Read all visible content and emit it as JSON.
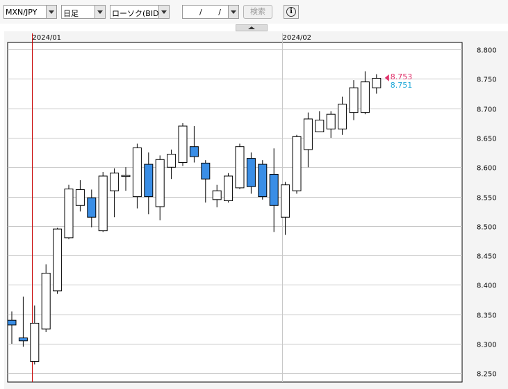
{
  "toolbar": {
    "pair": "MXN/JPY",
    "period": "日足",
    "chart_kind": "ローソク(BID)",
    "date_value": "/ /",
    "search_label": "検索",
    "info_glyph": "i",
    "icons": [
      "dropdown-arrow-icon",
      "info-icon",
      "collapse-up-icon"
    ]
  },
  "colors": {
    "up_fill": "#ffffff",
    "down_fill": "#3a8ee6",
    "candle_stroke": "#000000",
    "grid": "#c8c8c8",
    "month_separator": "#c8c8c8",
    "cursor_line": "#c80000",
    "ask_label": "#e0306a",
    "bid_label": "#1fa8d8"
  },
  "chart_data": {
    "type": "candlestick",
    "y_ticks": [
      "8.800",
      "8.750",
      "8.700",
      "8.650",
      "8.600",
      "8.550",
      "8.500",
      "8.450",
      "8.400",
      "8.350",
      "8.300",
      "8.250"
    ],
    "ylim": [
      8.235,
      8.812
    ],
    "x_month_labels": [
      {
        "label": "2024/01",
        "index": 1.75
      },
      {
        "label": "2024/02",
        "index": 23.75
      }
    ],
    "grid": true,
    "current_prices": [
      {
        "label": "8.753",
        "value": 8.753,
        "role": "ask"
      },
      {
        "label": "8.751",
        "value": 8.751,
        "role": "bid"
      }
    ],
    "candles": [
      {
        "o": 8.34,
        "h": 8.355,
        "l": 8.3,
        "c": 8.332
      },
      {
        "o": 8.31,
        "h": 8.38,
        "l": 8.295,
        "c": 8.305
      },
      {
        "o": 8.27,
        "h": 8.365,
        "l": 8.265,
        "c": 8.335
      },
      {
        "o": 8.325,
        "h": 8.435,
        "l": 8.32,
        "c": 8.42
      },
      {
        "o": 8.39,
        "h": 8.497,
        "l": 8.385,
        "c": 8.495
      },
      {
        "o": 8.48,
        "h": 8.57,
        "l": 8.478,
        "c": 8.563
      },
      {
        "o": 8.535,
        "h": 8.578,
        "l": 8.525,
        "c": 8.562
      },
      {
        "o": 8.548,
        "h": 8.562,
        "l": 8.498,
        "c": 8.515
      },
      {
        "o": 8.492,
        "h": 8.592,
        "l": 8.49,
        "c": 8.585
      },
      {
        "o": 8.56,
        "h": 8.598,
        "l": 8.515,
        "c": 8.59
      },
      {
        "o": 8.585,
        "h": 8.6,
        "l": 8.56,
        "c": 8.586
      },
      {
        "o": 8.55,
        "h": 8.64,
        "l": 8.53,
        "c": 8.633
      },
      {
        "o": 8.605,
        "h": 8.625,
        "l": 8.52,
        "c": 8.55
      },
      {
        "o": 8.533,
        "h": 8.62,
        "l": 8.51,
        "c": 8.613
      },
      {
        "o": 8.6,
        "h": 8.63,
        "l": 8.58,
        "c": 8.622
      },
      {
        "o": 8.608,
        "h": 8.675,
        "l": 8.602,
        "c": 8.67
      },
      {
        "o": 8.635,
        "h": 8.67,
        "l": 8.608,
        "c": 8.618
      },
      {
        "o": 8.607,
        "h": 8.612,
        "l": 8.54,
        "c": 8.58
      },
      {
        "o": 8.545,
        "h": 8.57,
        "l": 8.532,
        "c": 8.56
      },
      {
        "o": 8.543,
        "h": 8.59,
        "l": 8.54,
        "c": 8.585
      },
      {
        "o": 8.565,
        "h": 8.64,
        "l": 8.563,
        "c": 8.635
      },
      {
        "o": 8.615,
        "h": 8.625,
        "l": 8.555,
        "c": 8.567
      },
      {
        "o": 8.605,
        "h": 8.612,
        "l": 8.545,
        "c": 8.55
      },
      {
        "o": 8.588,
        "h": 8.632,
        "l": 8.49,
        "c": 8.535
      },
      {
        "o": 8.515,
        "h": 8.575,
        "l": 8.485,
        "c": 8.57
      },
      {
        "o": 8.56,
        "h": 8.655,
        "l": 8.555,
        "c": 8.652
      },
      {
        "o": 8.63,
        "h": 8.693,
        "l": 8.6,
        "c": 8.682
      },
      {
        "o": 8.66,
        "h": 8.695,
        "l": 8.66,
        "c": 8.68
      },
      {
        "o": 8.665,
        "h": 8.695,
        "l": 8.65,
        "c": 8.69
      },
      {
        "o": 8.665,
        "h": 8.72,
        "l": 8.655,
        "c": 8.707
      },
      {
        "o": 8.693,
        "h": 8.748,
        "l": 8.68,
        "c": 8.735
      },
      {
        "o": 8.693,
        "h": 8.763,
        "l": 8.69,
        "c": 8.745
      },
      {
        "o": 8.735,
        "h": 8.758,
        "l": 8.725,
        "c": 8.751
      }
    ]
  }
}
